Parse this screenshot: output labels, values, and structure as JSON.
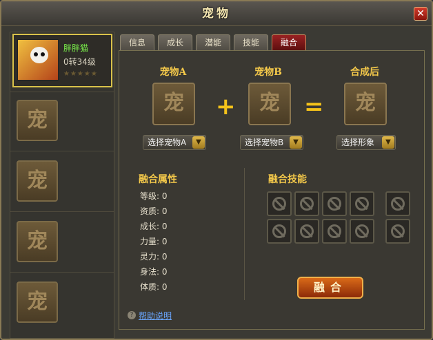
{
  "window": {
    "title": "宠物",
    "close_label": "✕"
  },
  "pet_list": {
    "selected": {
      "name": "胖胖猫",
      "level": "0转34级",
      "stars": "★★★★★"
    },
    "empty_slot_glyph": "宠"
  },
  "tabs": [
    "信息",
    "成长",
    "潜能",
    "技能",
    "融合"
  ],
  "active_tab_index": 4,
  "fusion": {
    "pet_a_label": "宠物A",
    "pet_b_label": "宠物B",
    "result_label": "合成后",
    "slot_glyph": "宠",
    "plus": "+",
    "equals": "=",
    "select_a": "选择宠物A",
    "select_b": "选择宠物B",
    "select_form": "选择形象",
    "attributes_title": "融合属性",
    "attributes": [
      {
        "label": "等级: 0"
      },
      {
        "label": "资质: 0"
      },
      {
        "label": "成长: 0"
      },
      {
        "label": "力量: 0"
      },
      {
        "label": "灵力: 0"
      },
      {
        "label": "身法: 0"
      },
      {
        "label": "体质: 0"
      }
    ],
    "skills_title": "融合技能",
    "fuse_button": "融合",
    "help_link": "帮助说明",
    "help_icon": "?"
  },
  "colors": {
    "accent": "#f3c84a",
    "active_tab": "#9a2222",
    "pet_name": "#7af04a",
    "link": "#6aa6ff"
  }
}
